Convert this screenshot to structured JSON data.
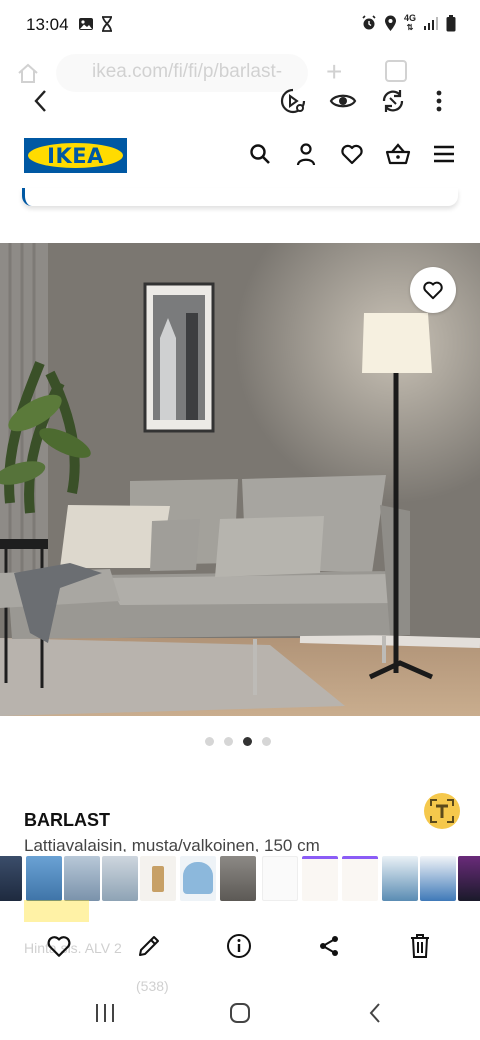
{
  "status_bar": {
    "time": "13:04",
    "left_icons": [
      "image-icon",
      "hourglass-icon"
    ],
    "right_icons": [
      "alarm-icon",
      "location-icon",
      "network-4g-icon",
      "signal-icon",
      "battery-icon"
    ],
    "network_label": "4G"
  },
  "browser": {
    "url": "ikea.com/fi/fi/p/barlast-"
  },
  "viewer_toolbar": {
    "icons": [
      "back-arrow-icon",
      "video-search-icon",
      "eye-icon",
      "rotate-icon",
      "more-vert-icon"
    ]
  },
  "ikea_header": {
    "logo_text": "IKEA",
    "icons": [
      "search-icon",
      "user-icon",
      "heart-icon",
      "basket-icon",
      "menu-icon"
    ]
  },
  "carousel": {
    "dot_count": 4,
    "active_index": 2
  },
  "product": {
    "name": "BARLAST",
    "description": "Lattiavalaisin, musta/valkoinen, 150 cm",
    "price_info": "Hinta sis. ALV 2",
    "reviews": "(538)"
  },
  "bottom_actions": {
    "icons": [
      "heart-outline-icon",
      "edit-icon",
      "info-icon",
      "share-icon",
      "delete-icon"
    ]
  },
  "nav_bar": {
    "icons": [
      "recents-icon",
      "home-icon",
      "back-icon"
    ]
  },
  "colors": {
    "ikea_blue": "#0058a3",
    "ikea_yellow": "#ffdb00",
    "translate_yellow": "#f5c84c",
    "wall": "#7d7973",
    "rug": "#b0aca6"
  }
}
